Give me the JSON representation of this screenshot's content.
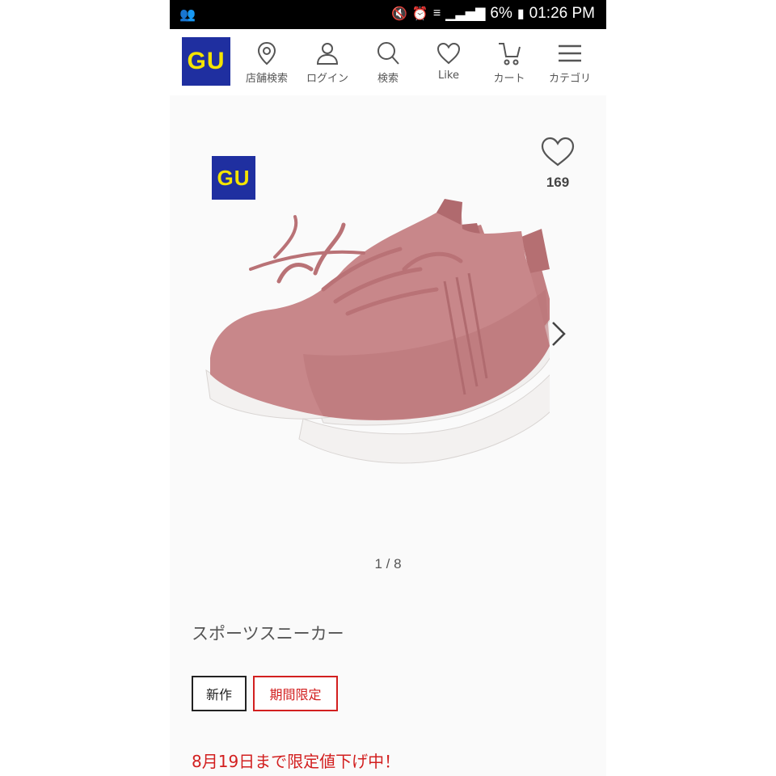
{
  "status_bar": {
    "battery": "6%",
    "time": "01:26 PM"
  },
  "header": {
    "logo": "GU",
    "nav": [
      {
        "label": "店舗検索",
        "icon": "location-pin-icon"
      },
      {
        "label": "ログイン",
        "icon": "user-icon"
      },
      {
        "label": "検索",
        "icon": "search-icon"
      },
      {
        "label": "Like",
        "icon": "heart-icon"
      },
      {
        "label": "カート",
        "icon": "cart-icon"
      },
      {
        "label": "カテゴリ",
        "icon": "menu-icon"
      }
    ]
  },
  "product": {
    "image_logo": "GU",
    "like_count": "169",
    "pager": "1 / 8",
    "title": "スポーツスニーカー",
    "tags": {
      "new": "新作",
      "limited": "期間限定"
    },
    "sale_text": "8月19日まで限定値下げ中！"
  },
  "colors": {
    "brand_blue": "#1f2fa0",
    "brand_yellow": "#f4e400",
    "sale_red": "#d21f1f",
    "shoe_pink": "#c07a7c"
  }
}
